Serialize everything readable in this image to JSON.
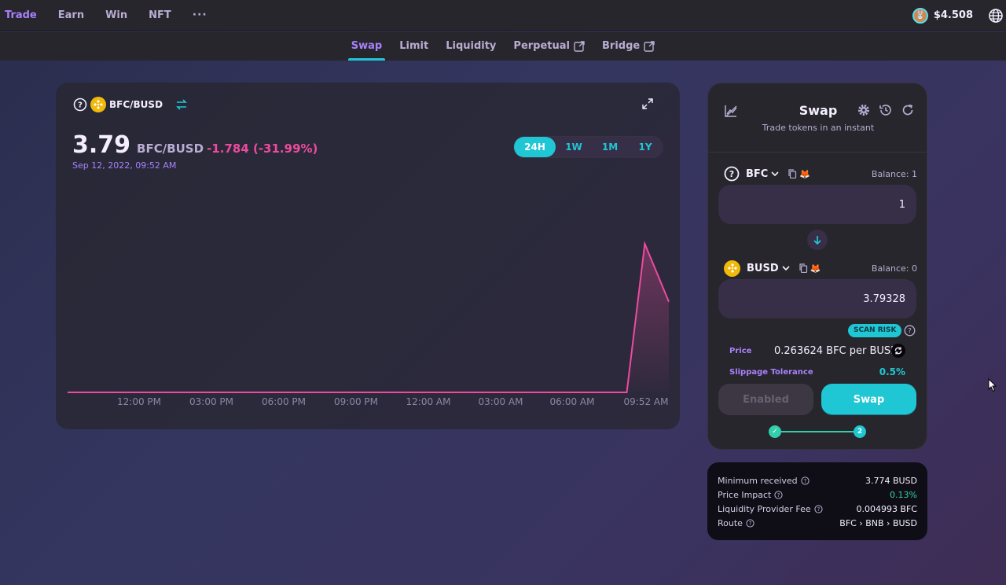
{
  "topnav": {
    "items": [
      "Trade",
      "Earn",
      "Win",
      "NFT",
      "···"
    ],
    "cake_price": "$4.508"
  },
  "subnav": {
    "tabs": [
      "Swap",
      "Limit",
      "Liquidity",
      "Perpetual",
      "Bridge"
    ],
    "active": "Swap"
  },
  "chart_panel": {
    "pair": "BFC/BUSD",
    "price": "3.79",
    "price_pair": "BFC/BUSD",
    "change": "-1.784 (-31.99%)",
    "date": "Sep 12, 2022, 09:52 AM",
    "ranges": [
      "24H",
      "1W",
      "1M",
      "1Y"
    ],
    "active_range": "24H"
  },
  "chart_data": {
    "type": "area",
    "x_labels": [
      "12:00 PM",
      "03:00 PM",
      "06:00 PM",
      "09:00 PM",
      "12:00 AM",
      "03:00 AM",
      "06:00 AM",
      "09:52 AM"
    ],
    "x": [
      0,
      0.93,
      0.96,
      1.0
    ],
    "y": [
      1.0,
      1.0,
      5.574,
      3.79
    ],
    "line_color": "#ed4b9e"
  },
  "swap": {
    "title": "Swap",
    "subtitle": "Trade tokens in an instant",
    "from": {
      "symbol": "BFC",
      "balance": "Balance: 1",
      "amount": "1"
    },
    "to": {
      "symbol": "BUSD",
      "balance": "Balance: 0",
      "amount": "3.79328"
    },
    "scan_risk": "SCAN RISK",
    "price_label": "Price",
    "price_value": "0.263624 BFC per BUSD",
    "slippage_label": "Slippage Tolerance",
    "slippage_value": "0.5%",
    "enabled_label": "Enabled",
    "swap_label": "Swap",
    "step1": "✓",
    "step2": "2"
  },
  "details": {
    "rows": [
      {
        "label": "Minimum received",
        "value": "3.774 BUSD"
      },
      {
        "label": "Price Impact",
        "value": "0.13%"
      },
      {
        "label": "Liquidity Provider Fee",
        "value": "0.004993 BFC"
      },
      {
        "label": "Route",
        "value": "BFC › BNB › BUSD"
      }
    ]
  }
}
